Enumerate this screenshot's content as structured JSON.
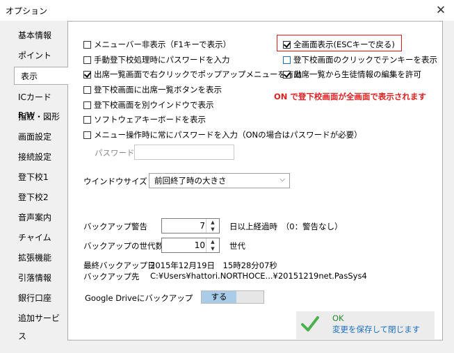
{
  "window": {
    "title": "オプション",
    "close_glyph": "✕"
  },
  "sidebar": {
    "items": [
      {
        "label": "基本情報"
      },
      {
        "label": "ポイント"
      },
      {
        "label": "表示",
        "active": true
      },
      {
        "label": "ICカードR/W"
      },
      {
        "label": "指紋・図形"
      },
      {
        "label": "画面設定"
      },
      {
        "label": "接続設定"
      },
      {
        "label": "登下校1"
      },
      {
        "label": "登下校2"
      },
      {
        "label": "音声案内"
      },
      {
        "label": "チャイム"
      },
      {
        "label": "拡張機能"
      },
      {
        "label": "引落情報"
      },
      {
        "label": "銀行口座"
      },
      {
        "label": "追加サービス"
      }
    ]
  },
  "checkboxes_left": [
    {
      "label": "メニューバー非表示（F1キーで表示）",
      "checked": false
    },
    {
      "label": "手動登下校処理時にパスワードを入力",
      "checked": false
    },
    {
      "label": "出席一覧画面で右クリックでポップアップメニューを有効",
      "checked": true
    },
    {
      "label": "登下校画面に出席一覧ボタンを表示",
      "checked": false
    },
    {
      "label": "登下校画面を別ウインドウで表示",
      "checked": false
    },
    {
      "label": "ソフトウェアキーボードを表示",
      "checked": false
    },
    {
      "label": "メニュー操作時に常にパスワードを入力（ONの場合はパスワードが必要）",
      "checked": false
    }
  ],
  "checkboxes_right": [
    {
      "label": "全画面表示(ESCキーで戻る)",
      "checked": true
    },
    {
      "label": "登下校画面のクリックでテンキーを表示",
      "checked": false
    },
    {
      "label": "出席一覧から生徒情報の編集を許可",
      "checked": true
    }
  ],
  "note": "ON で登下校画面が全画面で表示されます",
  "password": {
    "label": "パスワード",
    "value": ""
  },
  "window_size": {
    "label": "ウインドウサイズ",
    "selected": "前回終了時の大きさ"
  },
  "backup": {
    "warning_label": "バックアップ警告",
    "warning_value": "7",
    "warning_suffix": "日以上経過時　（0：警告なし）",
    "generations_label": "バックアップの世代数",
    "generations_value": "10",
    "generations_suffix": "世代",
    "last_label": "最終バックアップ日",
    "last_value": "2015年12月19日　15時28分07秒",
    "dest_label": "バックアップ先",
    "dest_value": "C:¥Users¥hattori.NORTHOCE...¥20151219net.PasSys4",
    "gdrive_label": "Google Driveにバックアップ",
    "gdrive_toggle": "する"
  },
  "ok_button": {
    "title": "OK",
    "subtitle": "変更を保存して閉じます"
  },
  "colors": {
    "accent": "#1a6fc4",
    "warning": "#e02020",
    "ok": "#2a8a2a"
  }
}
